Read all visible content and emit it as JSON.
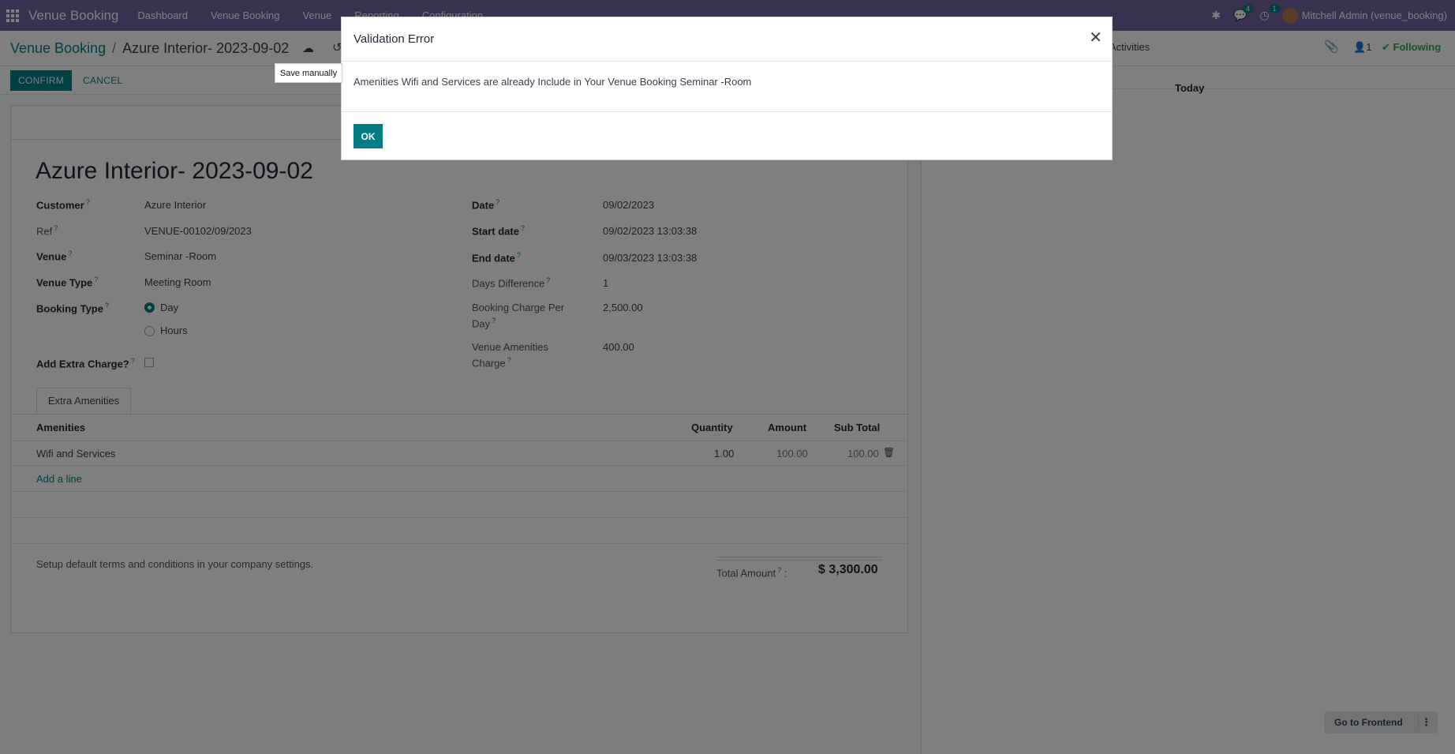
{
  "navbar": {
    "brand": "Venue Booking",
    "menu": [
      "Dashboard",
      "Venue Booking",
      "Venue",
      "Reporting",
      "Configuration"
    ],
    "messages_count": "4",
    "activities_count": "1",
    "user": "Mitchell Admin (venue_booking)"
  },
  "breadcrumb": {
    "parent": "Venue Booking",
    "separator": "/",
    "current": "Azure Interior- 2023-09-02"
  },
  "tooltip": "Save manually",
  "actions": {
    "confirm": "CONFIRM",
    "cancel": "CANCEL"
  },
  "chatter": {
    "activities": "Activities",
    "followers_count": "1",
    "following": "Following",
    "today": "Today",
    "go_frontend": "Go to Frontend"
  },
  "form": {
    "title": "Azure Interior- 2023-09-02",
    "customer_label": "Customer",
    "customer": "Azure Interior",
    "ref_label": "Ref",
    "ref": "VENUE-00102/09/2023",
    "venue_label": "Venue",
    "venue": "Seminar -Room",
    "venue_type_label": "Venue Type",
    "venue_type": "Meeting Room",
    "booking_type_label": "Booking Type",
    "booking_type_options": [
      "Day",
      "Hours"
    ],
    "booking_type_selected": "Day",
    "extra_charge_label": "Add Extra Charge?",
    "extra_charge_checked": false,
    "date_label": "Date",
    "date": "09/02/2023",
    "start_label": "Start date",
    "start": "09/02/2023 13:03:38",
    "end_label": "End date",
    "end": "09/03/2023 13:03:38",
    "days_diff_label": "Days Difference",
    "days_diff": "1",
    "charge_per_day_label_1": "Booking Charge Per",
    "charge_per_day_label_2": "Day",
    "charge_per_day": "2,500.00",
    "amenities_charge_label_1": "Venue Amenities",
    "amenities_charge_label_2": "Charge",
    "amenities_charge": "400.00"
  },
  "tab": {
    "label": "Extra Amenities"
  },
  "table": {
    "columns": [
      "Amenities",
      "Quantity",
      "Amount",
      "Sub Total"
    ],
    "rows": [
      {
        "amenity": "Wifi and Services",
        "quantity": "1.00",
        "amount": "100.00",
        "subtotal": "100.00"
      }
    ],
    "add_line": "Add a line"
  },
  "footer": {
    "terms": "Setup default terms and conditions in your company settings.",
    "total_label": "Total Amount",
    "total_suffix": ":",
    "total_value": "$ 3,300.00"
  },
  "modal": {
    "title": "Validation Error",
    "message": "Amenities Wifi and Services are already Include in Your Venue Booking Seminar -Room",
    "ok": "OK"
  },
  "colors": {
    "navbar": "#71639e",
    "primary": "#017e84",
    "following": "#28a745"
  }
}
